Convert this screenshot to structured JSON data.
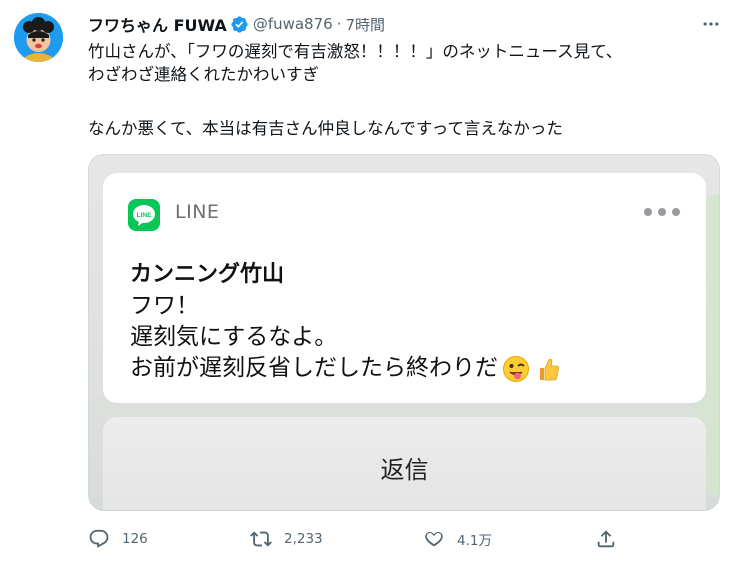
{
  "tweet": {
    "display_name": "フワちゃん FUWA",
    "handle": "@fuwa876",
    "separator": "·",
    "time": "7時間",
    "text_lines": [
      "竹山さんが、「フワの遅刻で有吉激怒！！！！」のネットニュース見て、",
      "わざわざ連絡くれたかわいすぎ",
      "なんか悪くて、本当は有吉さん仲良しなんですって言えなかった"
    ]
  },
  "notification": {
    "app_name": "LINE",
    "app_icon_text": "LINE",
    "sender": "カンニング竹山",
    "message_lines": [
      "フワ！",
      "遅刻気にするなよ。",
      "お前が遅刻反省しだしたら終わりだ"
    ],
    "reply_label": "返信"
  },
  "actions": {
    "replies": "126",
    "retweets": "2,233",
    "likes": "4.1万"
  },
  "colors": {
    "line_green": "#06c755",
    "verified_blue": "#1d9bf0",
    "muted_text": "#536471"
  },
  "icons": [
    "verified-badge-icon",
    "more-options-icon",
    "reply-icon",
    "retweet-icon",
    "like-icon",
    "share-icon",
    "line-app-icon"
  ]
}
